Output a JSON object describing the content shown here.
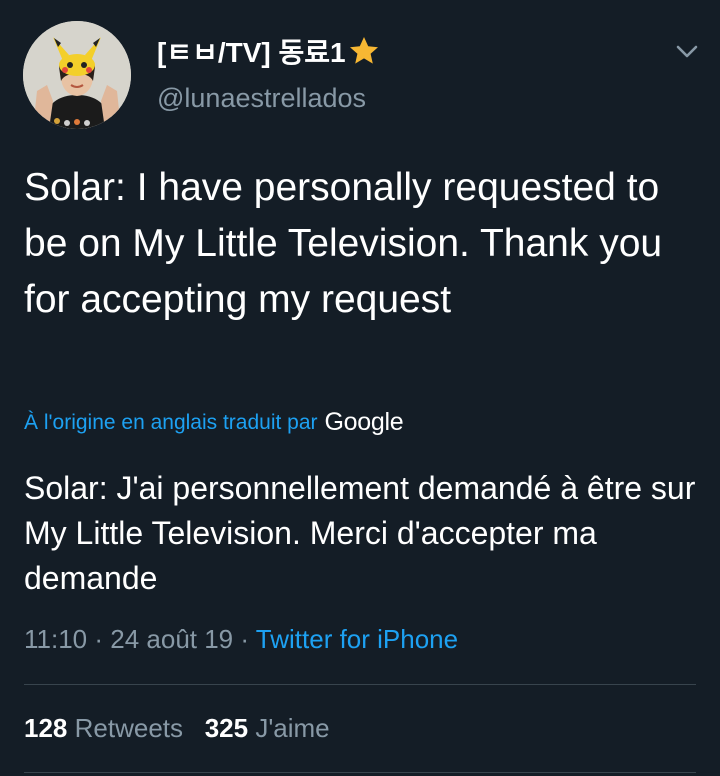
{
  "author": {
    "display_name": "[ㅌㅂ/TV] 동료1",
    "handle": "@lunaestrellados",
    "star_icon": "star-icon",
    "avatar_icon": "avatar"
  },
  "menu": {
    "icon": "chevron-down-icon"
  },
  "tweet": {
    "text": "Solar: I have personally requested to be on My Little Television. Thank you for accepting my request"
  },
  "translation": {
    "link_text": "À l'origine en anglais traduit par",
    "provider": "Google",
    "text": "Solar: J'ai personnellement demandé à être sur My Little Television. Merci d'accepter ma demande"
  },
  "meta": {
    "time": "11:10",
    "separator1": " · ",
    "date": "24 août 19",
    "separator2": " · ",
    "source": "Twitter for iPhone"
  },
  "stats": {
    "retweets_count": "128",
    "retweets_label": "Retweets",
    "likes_count": "325",
    "likes_label": "J'aime"
  },
  "colors": {
    "background": "#141d26",
    "accent": "#1da1f2",
    "secondary_text": "#8899a6",
    "divider": "#38444d",
    "star": "#f7b733"
  }
}
